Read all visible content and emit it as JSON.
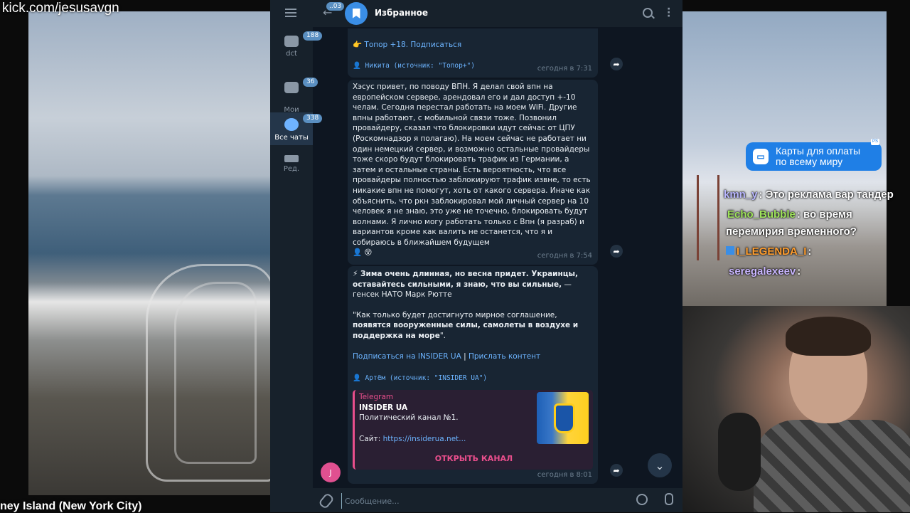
{
  "overlay": {
    "stream_url": "kick.com/jesusavgn",
    "camera_caption": "ney Island (New York City)",
    "promo": {
      "line1": "Карты для оплаты",
      "line2": "по всему миру",
      "badge": "PS"
    }
  },
  "stream_chat": [
    {
      "user": "kmn_y",
      "color": "#b9b7ff",
      "text": ": Это реклама вар тандер"
    },
    {
      "user": "Echo_Bubble",
      "color": "#9fe35b",
      "text": ": во время"
    },
    {
      "user": "",
      "color": "#ffffff",
      "text": "перемирия временного?"
    },
    {
      "user": "I_LEGENDA_I",
      "color": "#ff9d2e",
      "text": ":"
    },
    {
      "user": "seregalexeev",
      "color": "#c9b6ff",
      "text": ":"
    }
  ],
  "telegram": {
    "sidebar": [
      {
        "label": "dct",
        "badge": "188",
        "icon": "folder-icon"
      },
      {
        "label": "Мои\nдрузья",
        "badge": "36",
        "icon": "folder-icon"
      },
      {
        "label": "Все чаты",
        "badge": "338",
        "icon": "chat-bubble-icon",
        "active": true
      },
      {
        "label": "Ред.",
        "badge": "",
        "icon": "edit-folders-icon"
      }
    ],
    "header": {
      "back_badge": "..03",
      "title": "Избранное"
    },
    "messages": [
      {
        "link_text": "👉 Топор +18. Подписаться",
        "signature": "👤 Никита (источник: \"Топор+\")",
        "time": "сегодня в 7:31"
      },
      {
        "body": "Хэсус привет, по поводу ВПН. Я делал свой впн на европейском сервере, арендовал его и дал доступ +-10 челам. Сегодня перестал работать на моем WiFi. Другие впны работают, с мобильной связи тоже. Позвонил провайдеру, сказал что блокировки идут сейчас от ЦПУ (Роскомнадзор я полагаю). На моем сейчас не работает ни один немецкий сервер, и возможно остальные провайдеры тоже скоро будут блокировать трафик из Германии, а затем и остальные страны. Есть вероятность, что все провайдеры полностью заблокируют трафик извне, то есть никакие впн не помогут, хоть от какого сервера. Иначе как объяснить, что ркн заблокировал мой личный сервер на 10 человек я не знаю, это уже не точечно, блокировать будут волнами. Я лично могу работать только с Впн (я разраб) и вариантов кроме как валить не останется, что я и собираюсь в ближайшем будущем",
        "signature": "👤 😵",
        "time": "сегодня в 7:54"
      },
      {
        "quote_bold": "⚡ Зима очень длинная, но весна придет. Украинцы, оставайтесь сильными, я знаю, что вы сильные,",
        "quote_tail": " — генсек НАТО Марк Рютте",
        "quote2_start": "\"Как только будет достигнуто мирное соглашение, ",
        "quote2_bold": "появятся вооруженные силы, самолеты в воздухе и поддержка на море",
        "quote2_end": "\".",
        "link1": "Подписаться на INSIDER UA",
        "separator": " | ",
        "link2": "Прислать контент",
        "signature": "👤 Артём (источник: \"INSIDER UA\")",
        "preview": {
          "source": "Telegram",
          "title": "INSIDER UA",
          "description": "Политический канал №1.",
          "site_label": "Сайт: ",
          "site_link": "https://insiderua.net...",
          "button": "ОТКРЫТЬ КАНАЛ"
        },
        "time": "сегодня в 8:01"
      }
    ],
    "user_avatar_letter": "J",
    "input": {
      "placeholder": "Сообщение..."
    }
  }
}
